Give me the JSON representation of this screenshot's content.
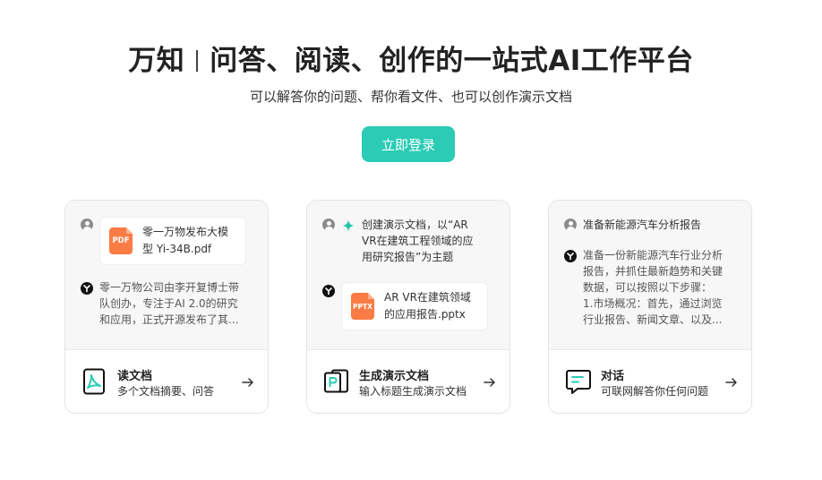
{
  "hero": {
    "brand": "万知",
    "tagline": "问答、阅读、创作的一站式AI工作平台",
    "subtitle": "可以解答你的问题、帮你看文件、也可以创作演示文档",
    "login_label": "立即登录"
  },
  "cards": [
    {
      "file_name_line1": "零一万物发布大模",
      "file_name_line2": "型 Yi-34B.pdf",
      "file_type": "PDF",
      "reply_lines": [
        "零一万物公司由李开复博士带",
        "队创办，专注于AI 2.0的研究",
        "和应用，正式开源发布了其..."
      ],
      "title": "读文档",
      "desc": "多个文档摘要、问答",
      "icon": "pdf-document-icon"
    },
    {
      "prompt_lines": [
        "创建演示文档，以“AR",
        "VR在建筑工程领域的应",
        "用研究报告”为主题"
      ],
      "file_name_line1": "AR VR在建筑领域",
      "file_name_line2": "的应用报告.pptx",
      "file_type": "PPTX",
      "title": "生成演示文档",
      "desc": "输入标题生成演示文档",
      "icon": "presentation-icon"
    },
    {
      "prompt": "准备新能源汽车分析报告",
      "reply_lines": [
        "准备一份新能源汽车行业分析",
        "报告，并抓住最新趋势和关键",
        "数据，可以按照以下步骤：",
        "1.市场概况：首先，通过浏览",
        "行业报告、新闻文章、以及..."
      ],
      "title": "对话",
      "desc": "可联网解答你任何问题",
      "icon": "chat-icon"
    }
  ],
  "colors": {
    "accent": "#2bcbb5",
    "file_orange": "#fb7b45",
    "sparkle": "#22c3a8"
  }
}
